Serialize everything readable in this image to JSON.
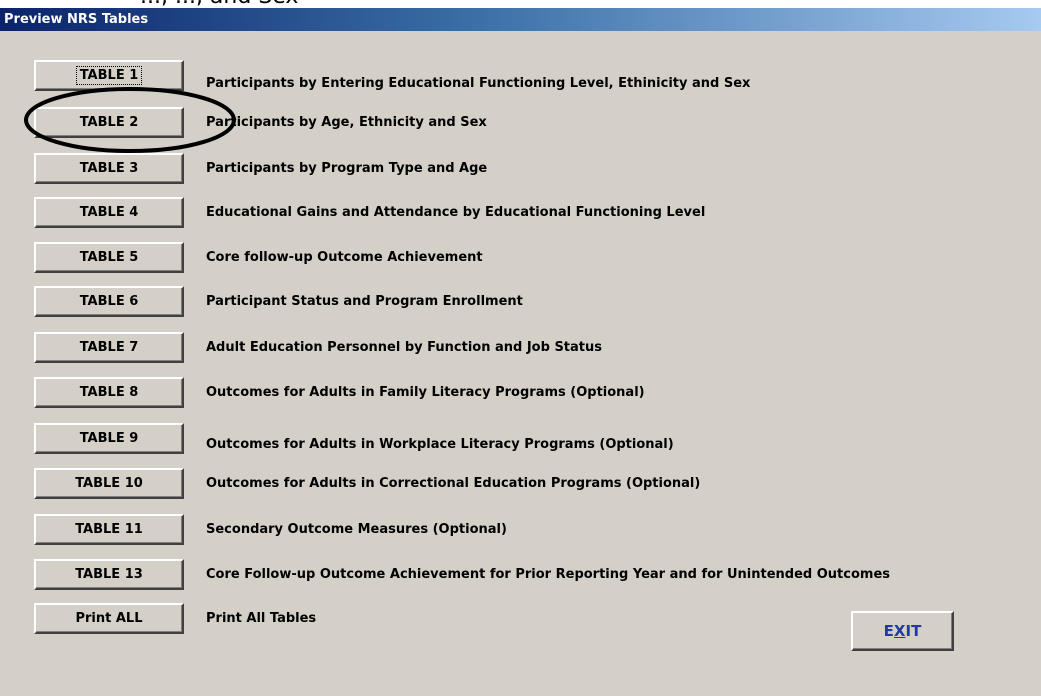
{
  "window": {
    "title": "Preview NRS Tables"
  },
  "tables": [
    {
      "button": "TABLE 1",
      "description": "Participants by Entering Educational Functioning Level, Ethinicity and Sex"
    },
    {
      "button": "TABLE 2",
      "description": "Participants by Age, Ethnicity and Sex"
    },
    {
      "button": "TABLE 3",
      "description": "Participants by Program Type and Age"
    },
    {
      "button": "TABLE 4",
      "description": "Educational Gains and Attendance by Educational Functioning Level"
    },
    {
      "button": "TABLE 5",
      "description": "Core follow-up Outcome Achievement"
    },
    {
      "button": "TABLE 6",
      "description": "Participant Status and Program Enrollment"
    },
    {
      "button": "TABLE 7",
      "description": "Adult Education Personnel by Function and Job Status"
    },
    {
      "button": "TABLE 8",
      "description": "Outcomes for Adults in Family Literacy Programs (Optional)"
    },
    {
      "button": "TABLE 9",
      "description": "Outcomes for Adults in Workplace Literacy Programs (Optional)"
    },
    {
      "button": "TABLE 10",
      "description": "Outcomes for Adults in Correctional Education Programs (Optional)"
    },
    {
      "button": "TABLE 11",
      "description": "Secondary Outcome Measures (Optional)"
    },
    {
      "button": "TABLE 13",
      "description": "Core Follow-up Outcome Achievement for Prior Reporting Year and for Unintended Outcomes"
    },
    {
      "button": "Print ALL",
      "description": "Print All Tables"
    }
  ],
  "exit": {
    "prefix": "E",
    "mnemonic": "X",
    "suffix": "IT"
  },
  "top_cut_text": "..., ..., and Sex",
  "focused_button": "TABLE 1",
  "annotation": {
    "shape": "ellipse",
    "color": "#000000",
    "target": "TABLE 2"
  }
}
